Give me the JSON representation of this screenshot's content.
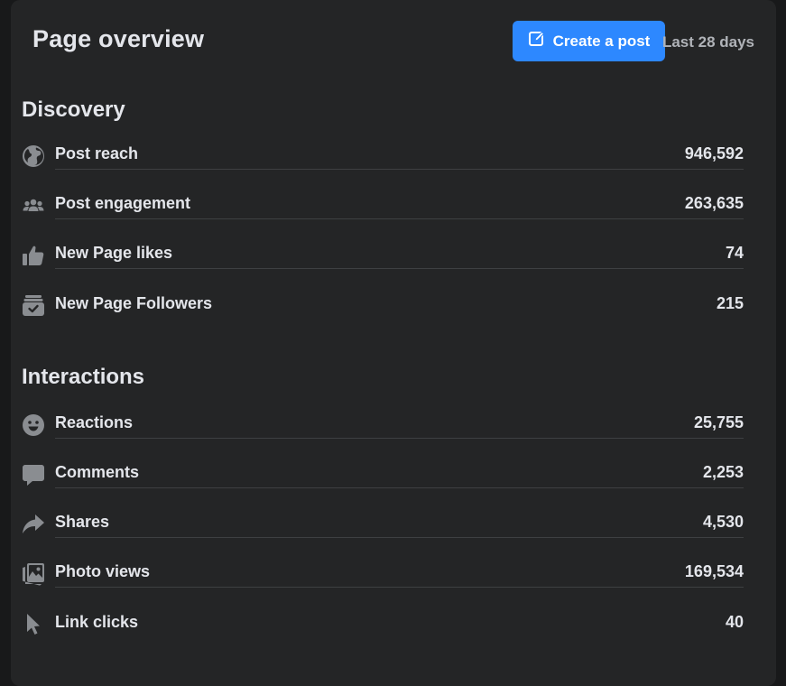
{
  "header": {
    "title": "Page overview",
    "create_label": "Create a post",
    "range_label": "Last 28 days"
  },
  "discovery": {
    "title": "Discovery",
    "items": [
      {
        "label": "Post reach",
        "value": "946,592",
        "icon": "globe-icon"
      },
      {
        "label": "Post engagement",
        "value": "263,635",
        "icon": "people-icon"
      },
      {
        "label": "New Page likes",
        "value": "74",
        "icon": "thumbs-up-icon"
      },
      {
        "label": "New Page Followers",
        "value": "215",
        "icon": "followers-icon"
      }
    ]
  },
  "interactions": {
    "title": "Interactions",
    "items": [
      {
        "label": "Reactions",
        "value": "25,755",
        "icon": "smiley-icon"
      },
      {
        "label": "Comments",
        "value": "2,253",
        "icon": "comment-icon"
      },
      {
        "label": "Shares",
        "value": "4,530",
        "icon": "share-icon"
      },
      {
        "label": "Photo views",
        "value": "169,534",
        "icon": "photo-icon"
      },
      {
        "label": "Link clicks",
        "value": "40",
        "icon": "cursor-icon"
      }
    ]
  },
  "colors": {
    "background": "#18191a",
    "card": "#242526",
    "accent": "#2d88ff",
    "text": "#e4e6eb",
    "secondary_text": "#b0b3b8",
    "icon": "#8a8d91",
    "divider": "#3e4042"
  }
}
